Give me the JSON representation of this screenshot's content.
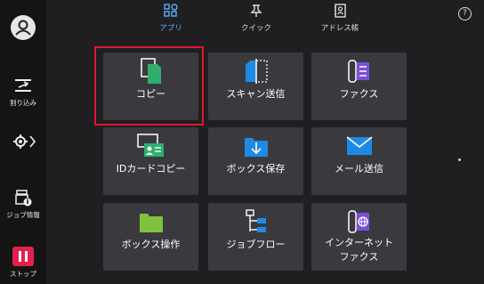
{
  "sidebar": {
    "interrupt_label": "割り込み",
    "job_status_label": "ジョブ情報",
    "stop_label": "ストップ"
  },
  "tabs": [
    {
      "label": "アプリ",
      "active": true
    },
    {
      "label": "クイック",
      "active": false
    },
    {
      "label": "アドレス帳",
      "active": false
    }
  ],
  "help_glyph": "?",
  "tiles": [
    {
      "label": "コピー",
      "icon": "copy-icon",
      "selected": true
    },
    {
      "label": "スキャン送信",
      "icon": "scan-icon"
    },
    {
      "label": "ファクス",
      "icon": "fax-icon"
    },
    {
      "label": "IDカードコピー",
      "icon": "id-card-icon"
    },
    {
      "label": "ボックス保存",
      "icon": "box-save-icon"
    },
    {
      "label": "メール送信",
      "icon": "mail-icon"
    },
    {
      "label": "ボックス操作",
      "icon": "folder-icon"
    },
    {
      "label": "ジョブフロー",
      "icon": "job-flow-icon"
    },
    {
      "label_line1": "インターネット",
      "label_line2": "ファクス",
      "icon": "internet-fax-icon"
    }
  ],
  "colors": {
    "accent_blue": "#5ab1ff",
    "selection_red": "#e3152f",
    "stop_red": "#e2204b",
    "copy_green": "#2fae6d",
    "fax_purple": "#7b4fd6",
    "scan_blue": "#1f8ae6"
  }
}
